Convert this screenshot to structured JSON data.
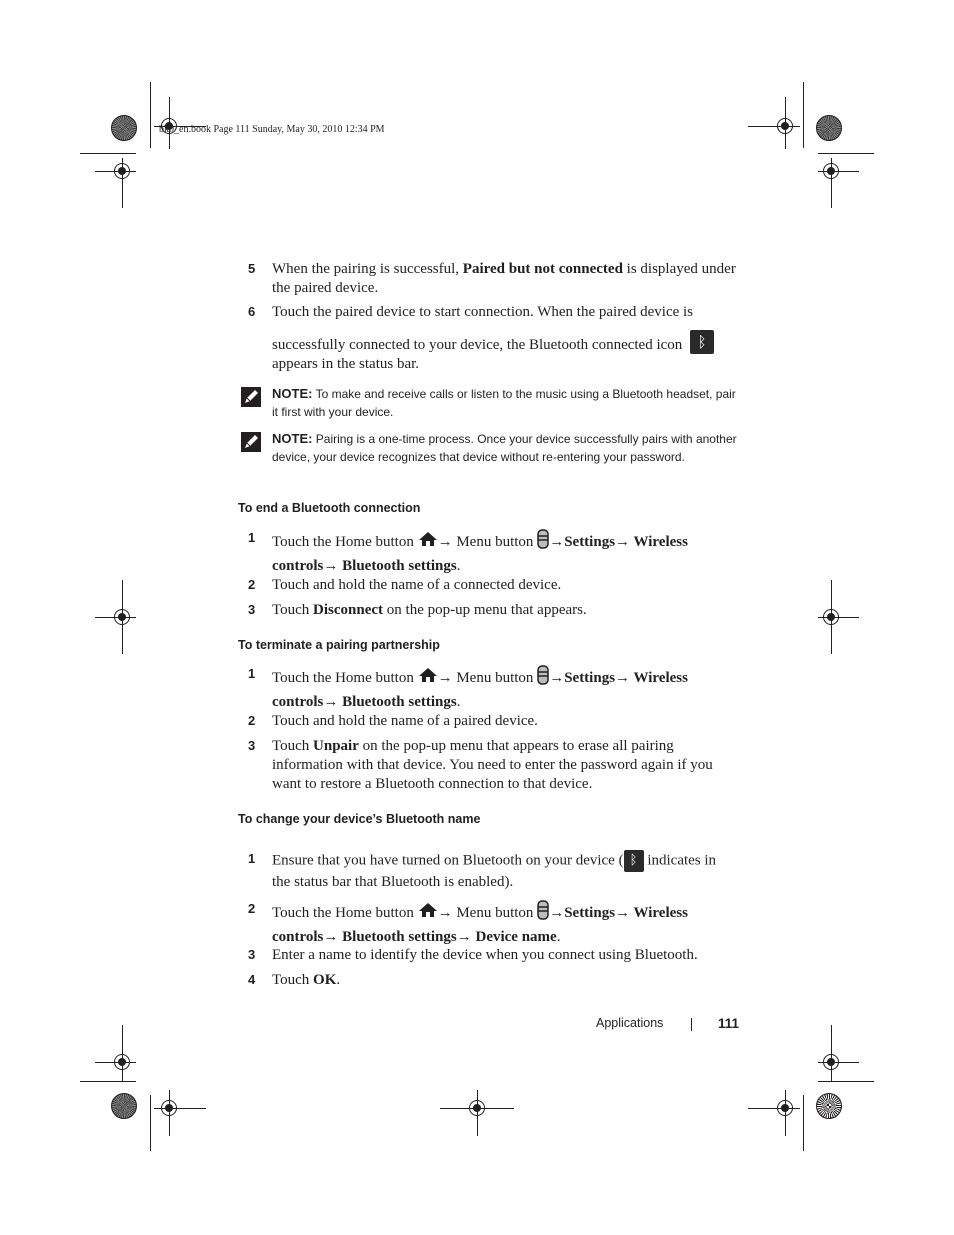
{
  "print_stamp": "bk0_en.book  Page 111  Sunday, May 30, 2010  12:34 PM",
  "steps_top": [
    {
      "num": "5",
      "parts": [
        {
          "t": "When the pairing is successful, "
        },
        {
          "t": "Paired but not connected",
          "b": true
        },
        {
          "t": " is displayed under the paired device."
        }
      ]
    },
    {
      "num": "6",
      "line1": "Touch the paired device to start connection. When the paired device is",
      "line2": "successfully connected to your device, the Bluetooth connected icon",
      "line3": "appears in the status bar.",
      "icon": "bluetooth-connected-icon"
    }
  ],
  "notes": [
    {
      "label": "NOTE:",
      "text": " To make and receive calls or listen to the music using a Bluetooth headset, pair it first with your device.",
      "icon": "note-pencil-icon"
    },
    {
      "label": "NOTE:",
      "text": " Pairing is a one-time process. Once your device successfully pairs with another device, your device recognizes that device without re-entering your password.",
      "icon": "note-pencil-icon"
    }
  ],
  "sections": [
    {
      "heading": "To end a Bluetooth connection",
      "steps": [
        {
          "num": "1",
          "type": "nav",
          "prefix": "Touch the Home button ",
          "menu": " Menu button ",
          "path1": "Settings",
          "path2": "Wireless",
          "path3": "controls",
          "path4": "Bluetooth settings",
          "suffix": "."
        },
        {
          "num": "2",
          "text": "Touch and hold the name of a connected device."
        },
        {
          "num": "3",
          "parts": [
            {
              "t": "Touch "
            },
            {
              "t": "Disconnect",
              "b": true
            },
            {
              "t": " on the pop-up menu that appears."
            }
          ]
        }
      ]
    },
    {
      "heading": "To terminate a pairing partnership",
      "steps": [
        {
          "num": "1",
          "type": "nav",
          "prefix": "Touch the Home button ",
          "menu": " Menu button ",
          "path1": "Settings",
          "path2": "Wireless",
          "path3": "controls",
          "path4": "Bluetooth settings",
          "suffix": "."
        },
        {
          "num": "2",
          "text": "Touch and hold the name of a paired device."
        },
        {
          "num": "3",
          "parts": [
            {
              "t": "Touch "
            },
            {
              "t": "Unpair",
              "b": true
            },
            {
              "t": " on the pop-up menu that appears to erase all pairing information with that device. You need to enter the password again if you want to restore a Bluetooth connection to that device."
            }
          ]
        }
      ]
    },
    {
      "heading": "To change your device’s Bluetooth name",
      "steps": [
        {
          "num": "1",
          "pre": "Ensure that you have turned on Bluetooth on your device (",
          "post": " indicates in the status bar that Bluetooth is enabled).",
          "icon": "bluetooth-enabled-icon"
        },
        {
          "num": "2",
          "type": "nav",
          "prefix": "Touch the Home button ",
          "menu": " Menu button ",
          "path1": "Settings",
          "path2": "Wireless",
          "path3": "controls",
          "path4": "Bluetooth settings",
          "path5": "Device name",
          "suffix": "."
        },
        {
          "num": "3",
          "text": "Enter a name to identify the device when you connect using Bluetooth."
        },
        {
          "num": "4",
          "parts": [
            {
              "t": "Touch "
            },
            {
              "t": "OK",
              "b": true
            },
            {
              "t": "."
            }
          ]
        }
      ]
    }
  ],
  "arrow": "→",
  "bt_glyph": "ᛒ",
  "footer": {
    "section": "Applications",
    "page": "111"
  }
}
